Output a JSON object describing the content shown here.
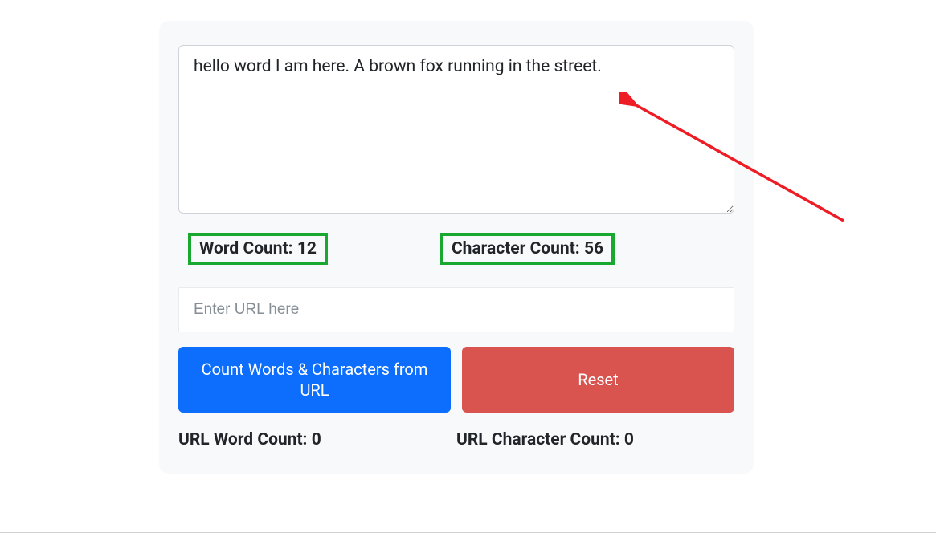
{
  "textarea": {
    "value": "hello word I am here. A brown fox running in the street."
  },
  "counts": {
    "word_label": "Word Count: ",
    "word_value": "12",
    "char_label": "Character Count: ",
    "char_value": "56"
  },
  "url_input": {
    "placeholder": "Enter URL here",
    "value": ""
  },
  "buttons": {
    "count_url": "Count Words & Characters from URL",
    "reset": "Reset"
  },
  "url_counts": {
    "word_label": "URL Word Count: ",
    "word_value": "0",
    "char_label": "URL Character Count: ",
    "char_value": "0"
  },
  "annotations": {
    "highlight_color": "#1aa830",
    "arrow_color": "#ee1c25"
  }
}
